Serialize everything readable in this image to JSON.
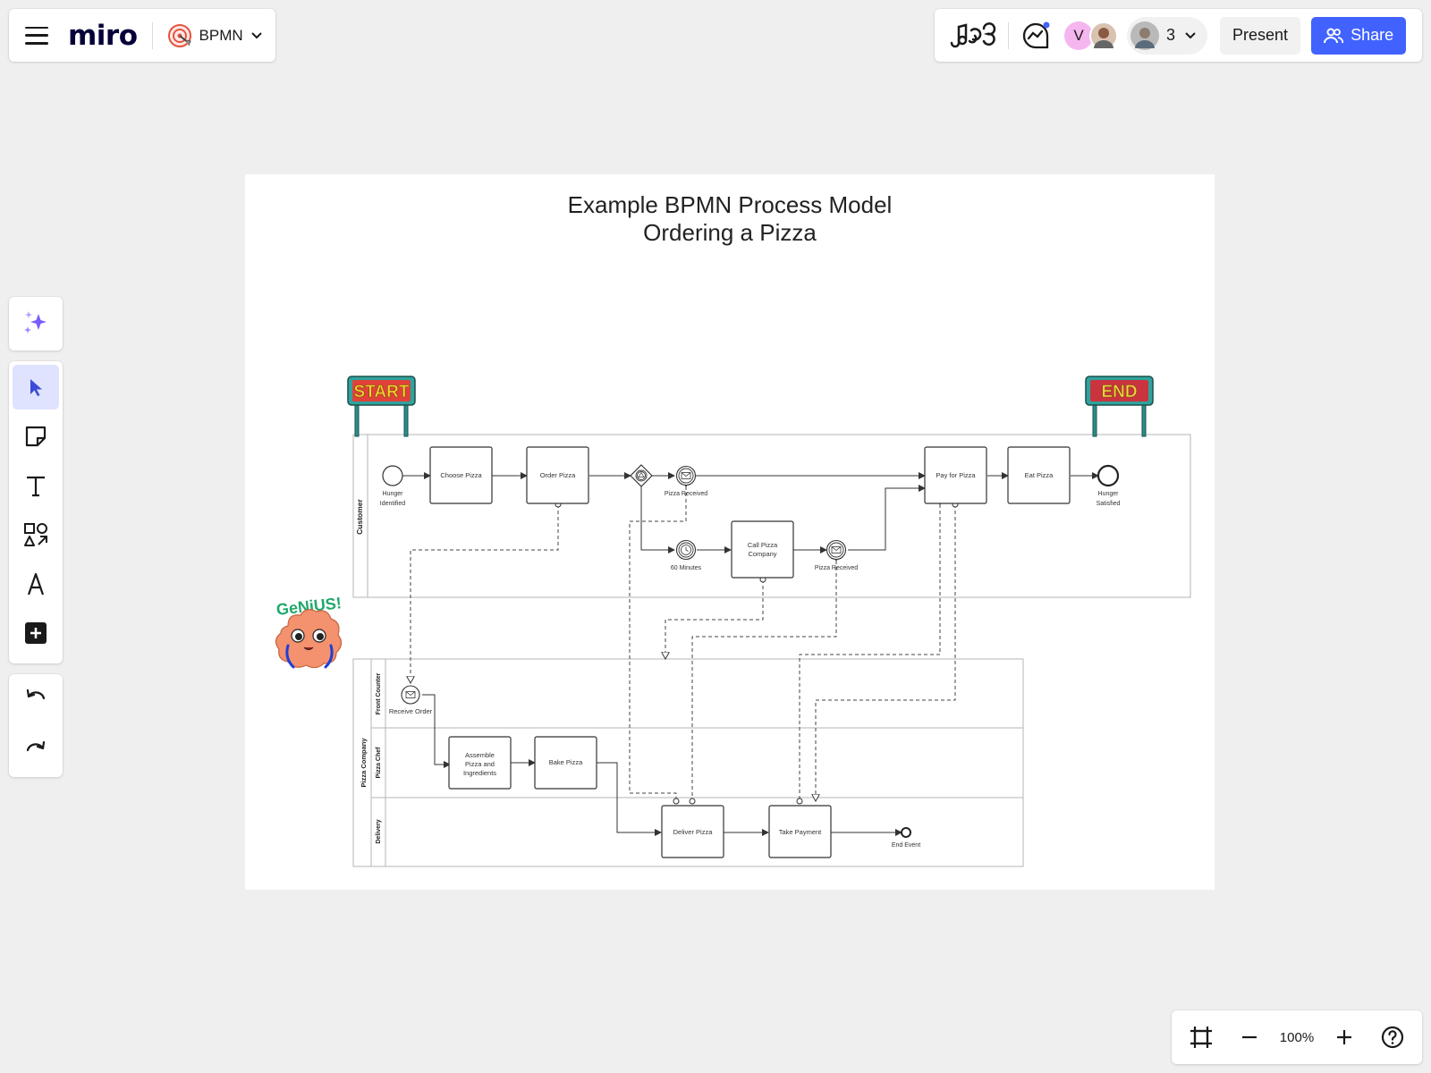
{
  "board": {
    "name": "BPMN",
    "logo": "miro"
  },
  "header": {
    "collaborator_initial": "V",
    "collaborator_count": "3",
    "present_label": "Present",
    "share_label": "Share",
    "brand_color": "#4262ff"
  },
  "toolbar": {
    "tools": [
      "ai-sparkle-icon",
      "select-icon",
      "sticky-note-icon",
      "text-icon",
      "shapes-icon",
      "pen-icon",
      "add-icon"
    ],
    "history": [
      "undo-icon",
      "redo-icon"
    ]
  },
  "zoom": {
    "level": "100%"
  },
  "frame": {
    "title_line1": "Example BPMN Process Model",
    "title_line2": "Ordering a Pizza"
  },
  "diagram": {
    "signs": {
      "start": "START",
      "end": "END"
    },
    "sticker": "GeNiUS!",
    "pools": {
      "customer": "Customer",
      "pizza_company": "Pizza Company"
    },
    "lanes": {
      "front_counter": "Front Counter",
      "pizza_chef": "Pizza Chef",
      "delivery": "Delivery"
    },
    "tasks": {
      "choose_pizza": "Choose Pizza",
      "order_pizza": "Order Pizza",
      "call_pizza_1": "Call Pizza",
      "call_pizza_2": "Company",
      "pay_for_pizza": "Pay for Pizza",
      "eat_pizza": "Eat Pizza",
      "assemble_1": "Assemble",
      "assemble_2": "Pizza and",
      "assemble_3": "Ingredients",
      "bake_pizza": "Bake Pizza",
      "deliver_pizza": "Deliver Pizza",
      "take_payment": "Take Payment"
    },
    "events": {
      "hunger_identified_1": "Hunger",
      "hunger_identified_2": "Identified",
      "pizza_received_a": "Pizza Received",
      "sixty_minutes": "60 Minutes",
      "pizza_received_b": "Pizza Received",
      "hunger_satisfied_1": "Hunger",
      "hunger_satisfied_2": "Satisfied",
      "receive_order": "Receive Order",
      "end_event": "End Event"
    }
  }
}
